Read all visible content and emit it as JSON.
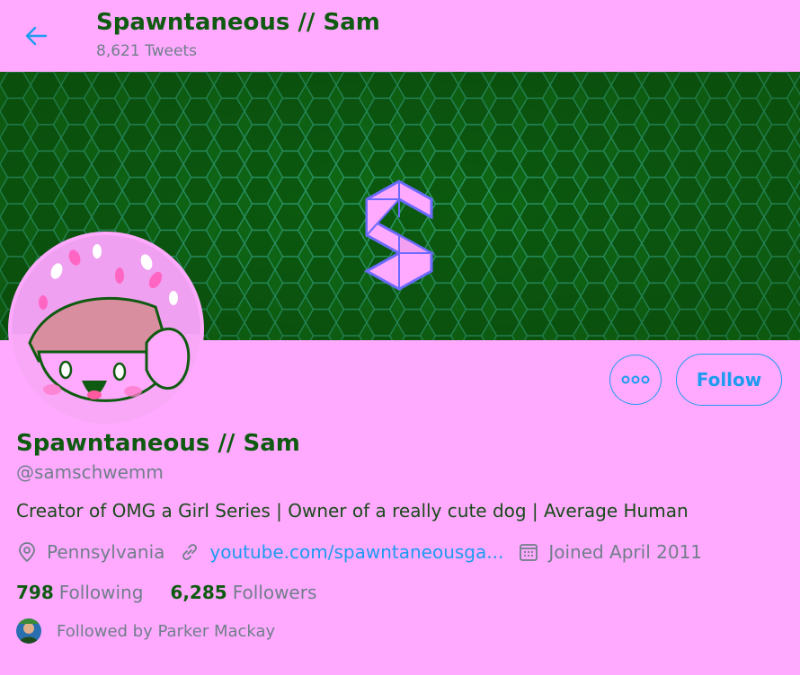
{
  "header": {
    "title": "Spawntaneous // Sam",
    "tweet_count": "8,621 Tweets"
  },
  "icons": {
    "back": "arrow-left-icon",
    "more": "more-horizontal-icon",
    "location": "location-pin-icon",
    "link": "link-icon",
    "calendar": "calendar-icon",
    "banner_logo": "s-logo"
  },
  "colors": {
    "background": "#ffaaff",
    "accent": "#1d9bf0",
    "name_text": "#0e5a10",
    "secondary_text": "#707e8a",
    "banner": "#0f6a12"
  },
  "profile": {
    "name": "Spawntaneous // Sam",
    "handle": "@samschwemm",
    "bio": "Creator of OMG a Girl Series | Owner of a really cute dog | Average Human",
    "location": "Pennsylvania",
    "website": "youtube.com/spawntaneousga...",
    "joined": "Joined April 2011",
    "following_count": "798",
    "following_label": "Following",
    "followers_count": "6,285",
    "followers_label": "Followers",
    "followed_by": "Followed by Parker Mackay"
  },
  "actions": {
    "follow_label": "Follow"
  }
}
